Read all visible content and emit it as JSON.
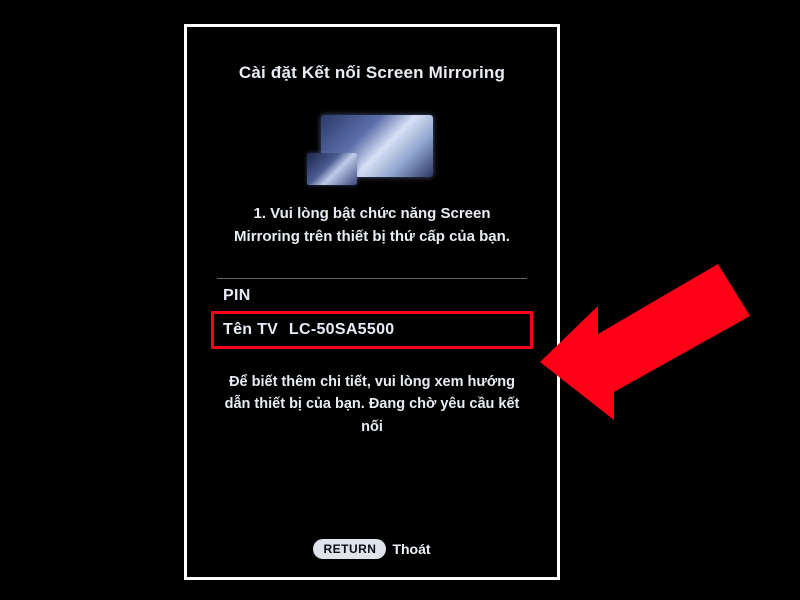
{
  "dialog": {
    "title": "Cài đặt Kết nối Screen Mirroring",
    "instruction": "1. Vui lòng bật chức năng Screen Mirroring trên thiết bị thứ cấp của bạn.",
    "pin_label": "PIN",
    "pin_value": "",
    "tvname_label": "Tên TV",
    "tvname_value": "LC-50SA5500",
    "footnote": "Để biết thêm chi tiết, vui lòng xem hướng dẫn thiết bị của bạn. Đang chờ yêu cầu kết nối",
    "return_button": "RETURN",
    "return_label": "Thoát"
  },
  "annotation": {
    "highlight_color": "#ff0016",
    "arrow_color": "#ff0016"
  }
}
